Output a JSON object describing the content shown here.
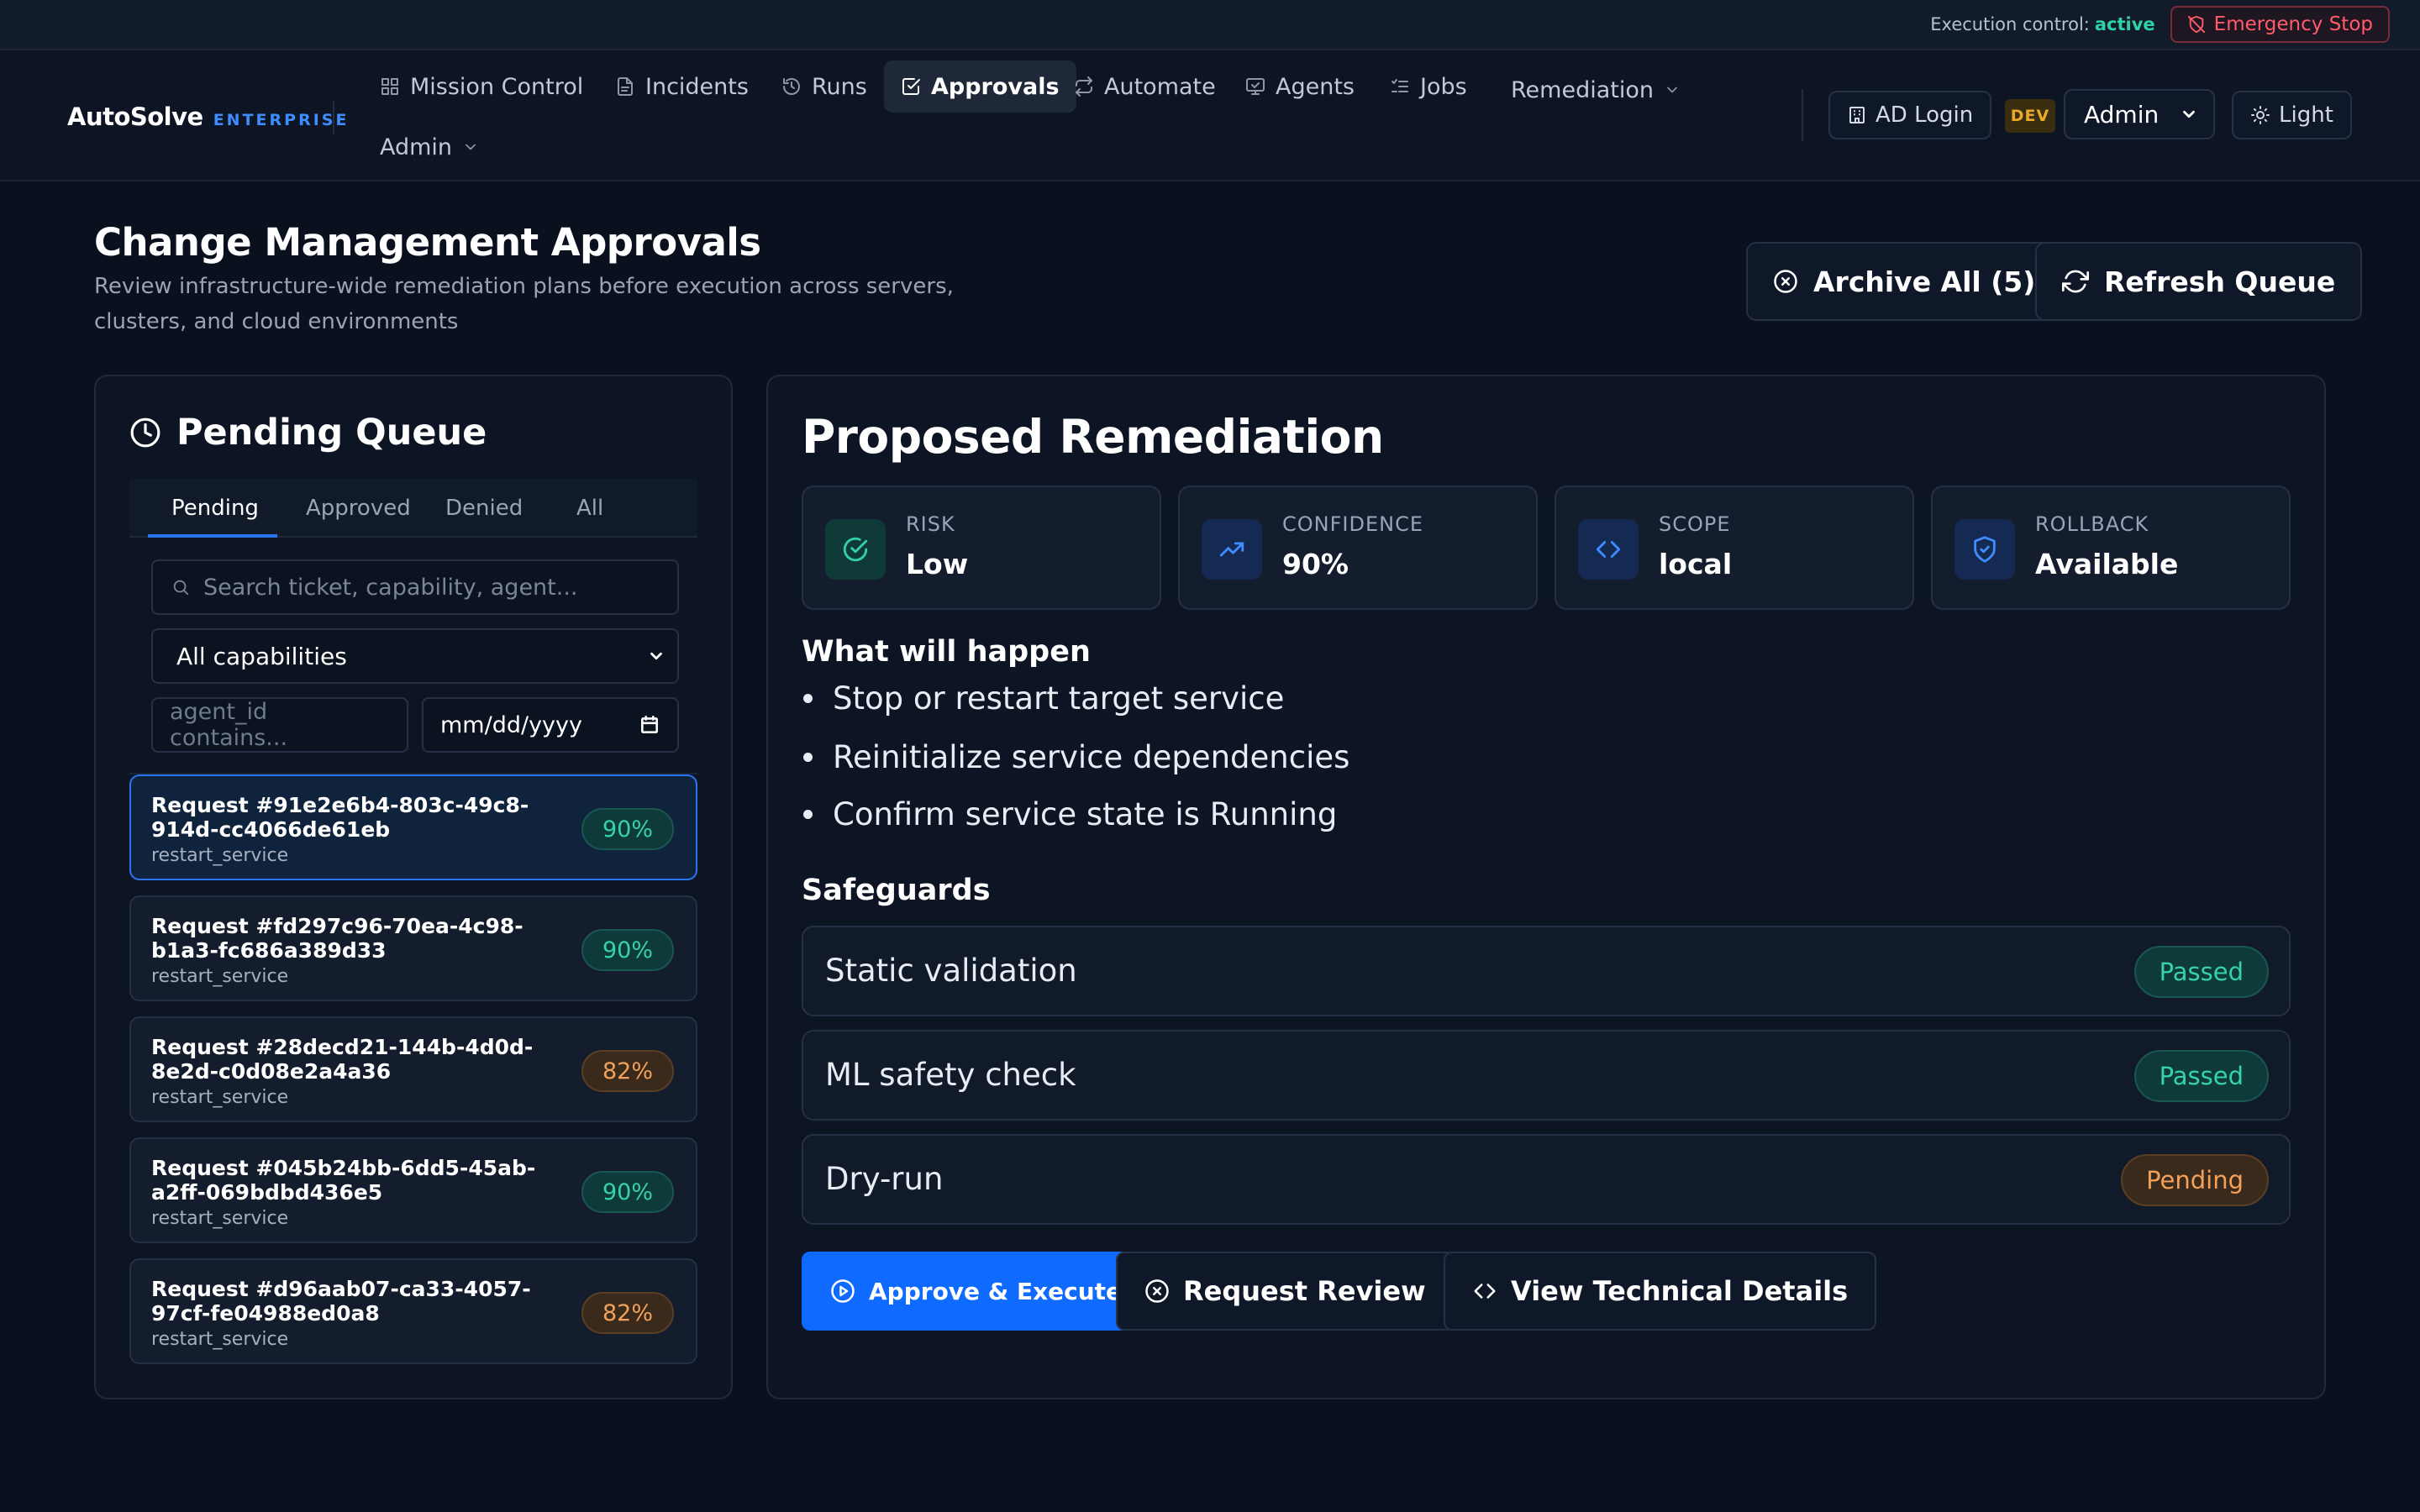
{
  "topbar": {
    "execution_label": "Execution control:",
    "execution_status": "active",
    "emergency_stop_label": "Emergency Stop"
  },
  "brand": {
    "name": "AutoSolve",
    "edition": "ENTERPRISE"
  },
  "nav": {
    "items": [
      {
        "label": "Mission Control",
        "icon": "grid-icon"
      },
      {
        "label": "Incidents",
        "icon": "document-icon"
      },
      {
        "label": "Runs",
        "icon": "history-icon"
      },
      {
        "label": "Approvals",
        "icon": "check-square-icon",
        "active": true
      },
      {
        "label": "Automate",
        "icon": "repeat-icon"
      },
      {
        "label": "Agents",
        "icon": "monitor-icon"
      },
      {
        "label": "Jobs",
        "icon": "list-check-icon"
      },
      {
        "label": "Remediation",
        "icon": "chevron-down-icon"
      },
      {
        "label": "Admin",
        "icon": "chevron-down-icon"
      }
    ],
    "ad_login_label": "AD Login",
    "env_badge": "DEV",
    "role_value": "Admin",
    "theme_label": "Light"
  },
  "page": {
    "title": "Change Management Approvals",
    "subtitle": "Review infrastructure-wide remediation plans before execution across servers, clusters, and cloud environments",
    "archive_label": "Archive All (5)",
    "refresh_label": "Refresh Queue"
  },
  "queue": {
    "title": "Pending Queue",
    "tabs": [
      "Pending",
      "Approved",
      "Denied",
      "All"
    ],
    "active_tab": "Pending",
    "search_placeholder": "Search ticket, capability, agent...",
    "capability_value": "All capabilities",
    "agent_placeholder": "agent_id contains...",
    "date_placeholder": "mm/dd/yyyy",
    "requests": [
      {
        "title": "Request #91e2e6b4-803c-49c8-914d-cc4066de61eb",
        "capability": "restart_service",
        "confidence": "90%",
        "level": "high",
        "selected": true
      },
      {
        "title": "Request #fd297c96-70ea-4c98-b1a3-fc686a389d33",
        "capability": "restart_service",
        "confidence": "90%",
        "level": "high"
      },
      {
        "title": "Request #28decd21-144b-4d0d-8e2d-c0d08e2a4a36",
        "capability": "restart_service",
        "confidence": "82%",
        "level": "medium"
      },
      {
        "title": "Request #045b24bb-6dd5-45ab-a2ff-069bdbd436e5",
        "capability": "restart_service",
        "confidence": "90%",
        "level": "high"
      },
      {
        "title": "Request #d96aab07-ca33-4057-97cf-fe04988ed0a8",
        "capability": "restart_service",
        "confidence": "82%",
        "level": "medium"
      }
    ]
  },
  "remediation": {
    "title": "Proposed Remediation",
    "stats": [
      {
        "label": "RISK",
        "value": "Low",
        "icon": "check-circle-icon",
        "color": "#34d1a6"
      },
      {
        "label": "CONFIDENCE",
        "value": "90%",
        "icon": "trending-up-icon",
        "color": "#3f8cff"
      },
      {
        "label": "SCOPE",
        "value": "local",
        "icon": "code-icon",
        "color": "#3f8cff"
      },
      {
        "label": "ROLLBACK",
        "value": "Available",
        "icon": "shield-check-icon",
        "color": "#3f8cff"
      }
    ],
    "what_heading": "What will happen",
    "steps": [
      "Stop or restart target service",
      "Reinitialize service dependencies",
      "Confirm service state is Running"
    ],
    "safeguards_heading": "Safeguards",
    "safeguards": [
      {
        "label": "Static validation",
        "status": "Passed"
      },
      {
        "label": "ML safety check",
        "status": "Passed"
      },
      {
        "label": "Dry-run",
        "status": "Pending"
      }
    ],
    "approve_label": "Approve & Execute",
    "review_label": "Request Review",
    "details_label": "View Technical Details"
  },
  "colors": {
    "background": "#0a101d",
    "accent": "#0f6bff",
    "success": "#36d3a8",
    "warning": "#f3a05a",
    "danger": "#ff5b6b"
  }
}
